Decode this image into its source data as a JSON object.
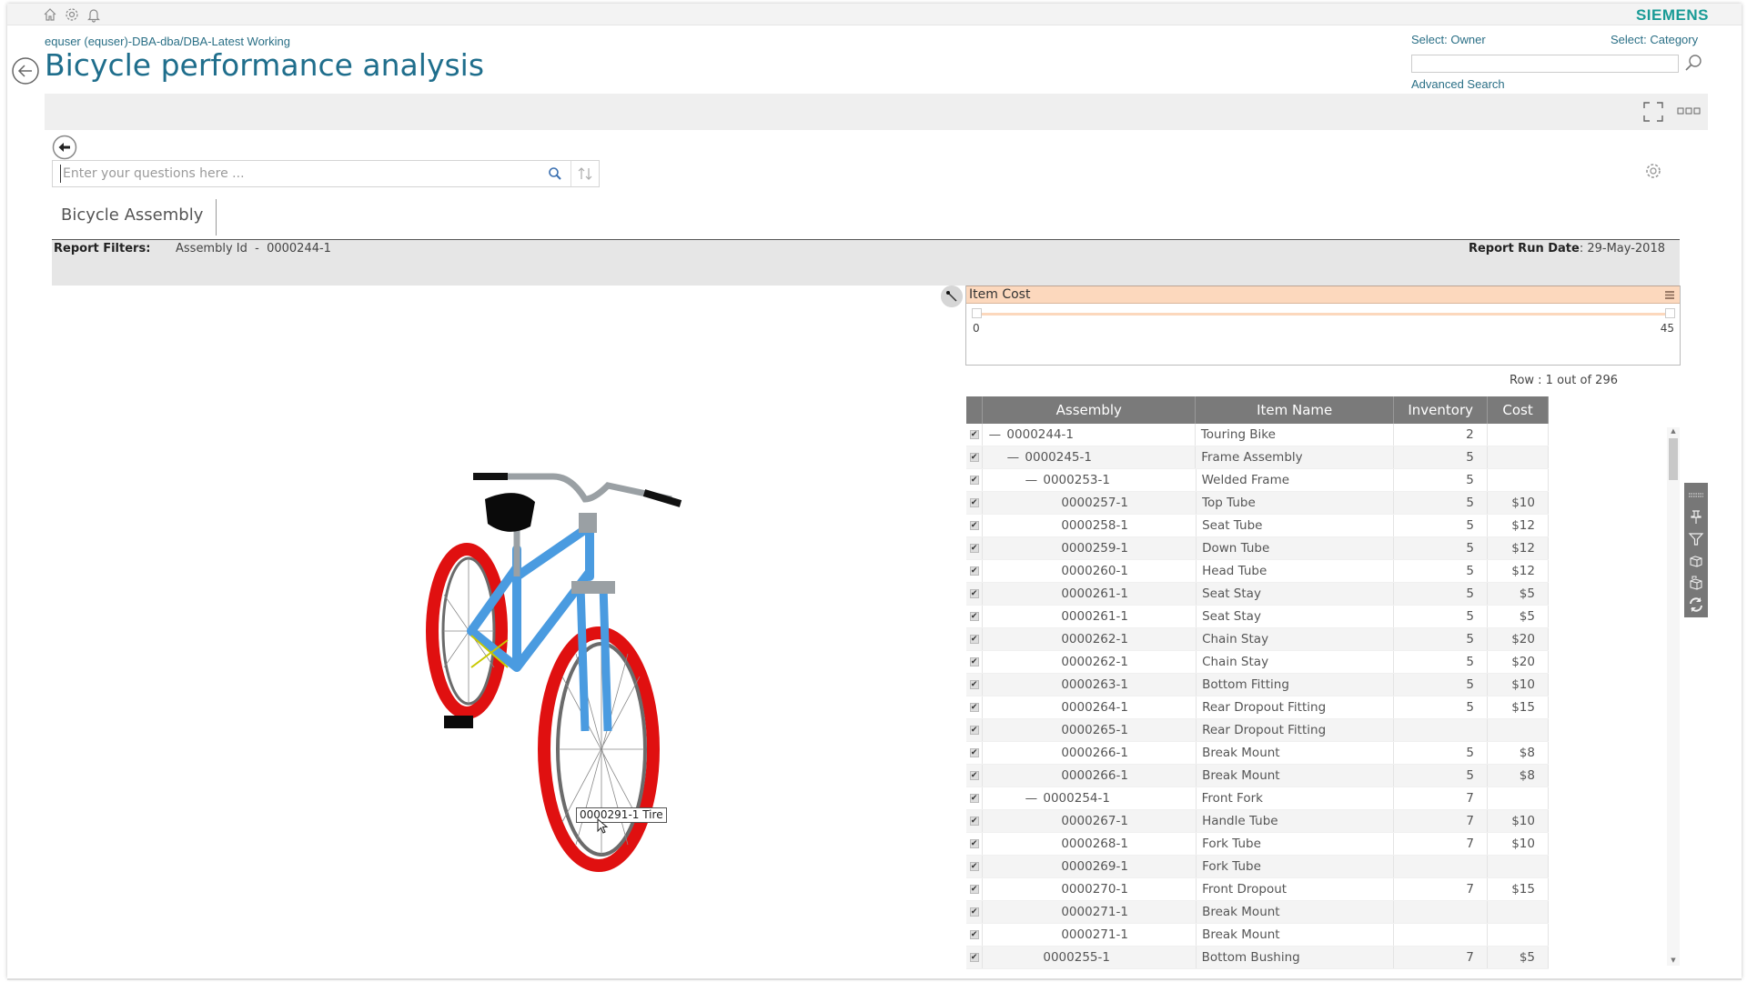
{
  "topbar": {
    "icons": [
      "home-icon",
      "gear-icon",
      "bell-icon"
    ],
    "brand": "SIEMENS",
    "brand_color": "#199b96"
  },
  "header": {
    "breadcrumb": "equser (equser)-DBA-dba/DBA-Latest Working",
    "title": "Bicycle performance analysis",
    "select_owner_label": "Select: Owner",
    "select_category_label": "Select: Category",
    "owner_search_value": "",
    "advanced_search_label": "Advanced Search"
  },
  "query": {
    "placeholder": "Enter your questions here ...",
    "value": ""
  },
  "report": {
    "tab_title": "Bicycle Assembly",
    "filters_label": "Report Filters:",
    "filters_value": "Assembly Id  -  0000244-1",
    "run_date_label": "Report Run Date",
    "run_date_value": ": 29-May-2018"
  },
  "cost_filter": {
    "title": "Item Cost",
    "min": "0",
    "max": "45",
    "range_low": 0,
    "range_high": 45
  },
  "grid": {
    "row_count": "Row : 1 out of 296",
    "columns": [
      "Assembly",
      "Item Name",
      "Inventory",
      "Cost"
    ],
    "rows": [
      {
        "level": 0,
        "toggle": "—",
        "assembly": "0000244-1",
        "name": "Touring Bike",
        "inventory": "2",
        "cost": ""
      },
      {
        "level": 1,
        "toggle": "—",
        "assembly": "0000245-1",
        "name": "Frame Assembly",
        "inventory": "5",
        "cost": ""
      },
      {
        "level": 2,
        "toggle": "—",
        "assembly": "0000253-1",
        "name": "Welded Frame",
        "inventory": "5",
        "cost": ""
      },
      {
        "level": 3,
        "toggle": "",
        "assembly": "0000257-1",
        "name": "Top Tube",
        "inventory": "5",
        "cost": "$10"
      },
      {
        "level": 3,
        "toggle": "",
        "assembly": "0000258-1",
        "name": "Seat Tube",
        "inventory": "5",
        "cost": "$12"
      },
      {
        "level": 3,
        "toggle": "",
        "assembly": "0000259-1",
        "name": "Down Tube",
        "inventory": "5",
        "cost": "$12"
      },
      {
        "level": 3,
        "toggle": "",
        "assembly": "0000260-1",
        "name": "Head Tube",
        "inventory": "5",
        "cost": "$12"
      },
      {
        "level": 3,
        "toggle": "",
        "assembly": "0000261-1",
        "name": "Seat Stay",
        "inventory": "5",
        "cost": "$5"
      },
      {
        "level": 3,
        "toggle": "",
        "assembly": "0000261-1",
        "name": "Seat Stay",
        "inventory": "5",
        "cost": "$5"
      },
      {
        "level": 3,
        "toggle": "",
        "assembly": "0000262-1",
        "name": "Chain Stay",
        "inventory": "5",
        "cost": "$20"
      },
      {
        "level": 3,
        "toggle": "",
        "assembly": "0000262-1",
        "name": "Chain Stay",
        "inventory": "5",
        "cost": "$20"
      },
      {
        "level": 3,
        "toggle": "",
        "assembly": "0000263-1",
        "name": "Bottom Fitting",
        "inventory": "5",
        "cost": "$10"
      },
      {
        "level": 3,
        "toggle": "",
        "assembly": "0000264-1",
        "name": "Rear Dropout Fitting",
        "inventory": "5",
        "cost": "$15"
      },
      {
        "level": 3,
        "toggle": "",
        "assembly": "0000265-1",
        "name": "Rear Dropout Fitting",
        "inventory": "",
        "cost": ""
      },
      {
        "level": 3,
        "toggle": "",
        "assembly": "0000266-1",
        "name": "Break Mount",
        "inventory": "5",
        "cost": "$8"
      },
      {
        "level": 3,
        "toggle": "",
        "assembly": "0000266-1",
        "name": "Break Mount",
        "inventory": "5",
        "cost": "$8"
      },
      {
        "level": 2,
        "toggle": "—",
        "assembly": "0000254-1",
        "name": "Front Fork",
        "inventory": "7",
        "cost": ""
      },
      {
        "level": 3,
        "toggle": "",
        "assembly": "0000267-1",
        "name": "Handle Tube",
        "inventory": "7",
        "cost": "$10"
      },
      {
        "level": 3,
        "toggle": "",
        "assembly": "0000268-1",
        "name": "Fork Tube",
        "inventory": "7",
        "cost": "$10"
      },
      {
        "level": 3,
        "toggle": "",
        "assembly": "0000269-1",
        "name": "Fork Tube",
        "inventory": "",
        "cost": ""
      },
      {
        "level": 3,
        "toggle": "",
        "assembly": "0000270-1",
        "name": "Front Dropout",
        "inventory": "7",
        "cost": "$15"
      },
      {
        "level": 3,
        "toggle": "",
        "assembly": "0000271-1",
        "name": "Break Mount",
        "inventory": "",
        "cost": ""
      },
      {
        "level": 3,
        "toggle": "",
        "assembly": "0000271-1",
        "name": "Break Mount",
        "inventory": "",
        "cost": ""
      },
      {
        "level": 2,
        "toggle": "",
        "assembly": "0000255-1",
        "name": "Bottom Bushing",
        "inventory": "7",
        "cost": "$5"
      }
    ]
  },
  "side_tools": [
    "grid-lines-icon",
    "pin-icon",
    "filter-icon",
    "cube-icon",
    "cube-group-icon",
    "refresh-icon"
  ],
  "viewer": {
    "model": "bicycle-3d-model",
    "tooltip": "0000291-1 Tire",
    "colors": {
      "tire": "#e01010",
      "frame": "#4a9be0",
      "metal": "#9aa0a4"
    }
  }
}
